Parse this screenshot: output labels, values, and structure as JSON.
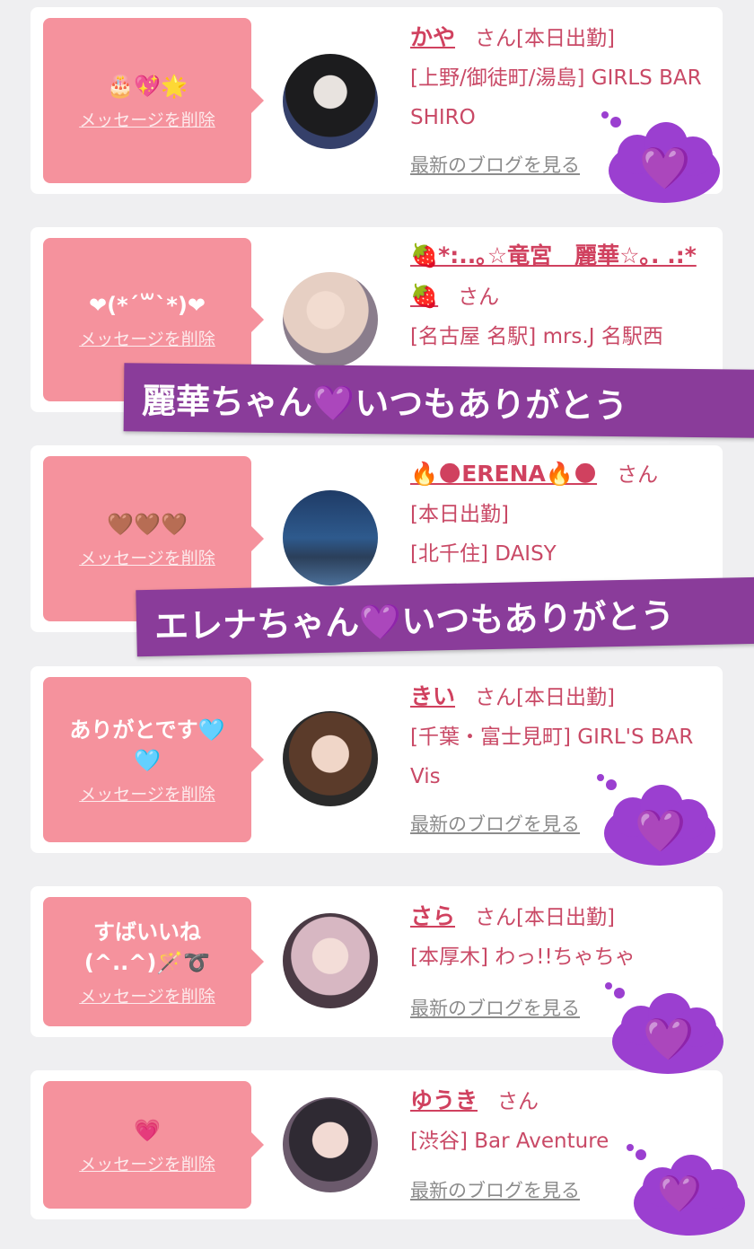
{
  "delete_label": "メッセージを削除",
  "blog_label": "最新のブログを見る",
  "san_label": "さん",
  "colors": {
    "card_bg": "#ffffff",
    "bubble_bg": "#f5929d",
    "name": "#d0415f",
    "banner_bg": "#8a3c9a",
    "cloud": "#9b3fd0"
  },
  "messages": [
    {
      "message": "🎂💖🌟",
      "name": "かや",
      "shift": "[本日出勤]",
      "shop": "[上野/御徒町/湯島] GIRLS BAR SHIRO",
      "avatar_icon": "girl-dark-hair-avatar"
    },
    {
      "message": "❤(*´꒳`*)❤",
      "name": "🍓*:..｡☆竜宮　麗華☆｡. .:*🍓",
      "shift": "",
      "shop": "[名古屋 名駅] mrs.J 名駅西",
      "avatar_icon": "girl-blonde-avatar"
    },
    {
      "message": "🤎🤎🤎",
      "name": "🔥🌑ERENA🔥🌑",
      "shift": "[本日出勤]",
      "shop": "[北千住] DAISY",
      "avatar_icon": "skytree-night-avatar"
    },
    {
      "message": "ありがとです🩵🩵",
      "name": "きい",
      "shift": "[本日出勤]",
      "shop": "[千葉・富士見町] GIRL'S BAR Vis",
      "avatar_icon": "girl-brown-hair-avatar"
    },
    {
      "message": "すばいいね(^..^)🪄➰",
      "name": "さら",
      "shift": "[本日出勤]",
      "shop": "[本厚木] わっ!!ちゃちゃ",
      "avatar_icon": "girl-sticker-avatar"
    },
    {
      "message": "💗",
      "name": "ゆうき",
      "shift": "",
      "shop": "[渋谷] Bar Aventure",
      "avatar_icon": "girl-peace-sign-avatar"
    }
  ],
  "banners": [
    {
      "text": "麗華ちゃん💜いつもありがとう"
    },
    {
      "text": "エレナちゃん💜いつもありがとう"
    }
  ],
  "heart_glyph": "💜"
}
